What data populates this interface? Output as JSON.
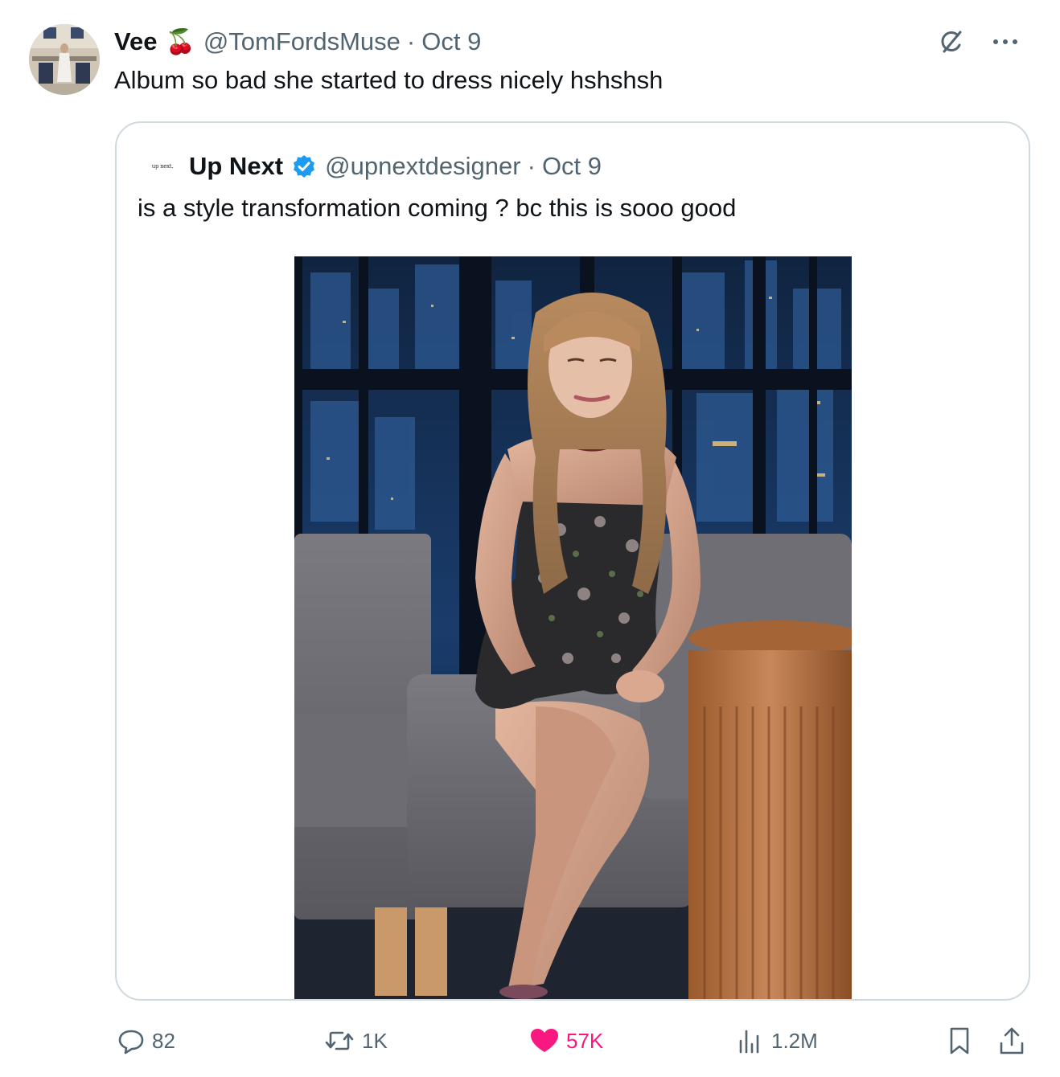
{
  "tweet": {
    "author_name": "Vee",
    "author_emoji": "🍒",
    "author_handle": "@TomFordsMuse",
    "separator": "·",
    "date": "Oct 9",
    "text": "Album so bad she started to dress nicely hshshsh"
  },
  "quoted": {
    "logo_text": "up next.",
    "author_name": "Up Next",
    "verified": true,
    "author_handle": "@upnextdesigner",
    "separator": "·",
    "date": "Oct 9",
    "text": "is a style transformation coming ? bc this is sooo good",
    "image_icon": "photo-woman-seated-talk-show"
  },
  "actions": {
    "replies": "82",
    "reposts": "1K",
    "likes": "57K",
    "views": "1.2M"
  },
  "colors": {
    "text_primary": "#0f1419",
    "text_secondary": "#536471",
    "border": "#cfd9de",
    "like": "#f91880",
    "verified": "#1d9bf0"
  },
  "icons": {
    "grok": "grok-icon",
    "more": "more-icon",
    "reply": "reply-icon",
    "repost": "repost-icon",
    "like": "heart-icon",
    "views": "views-icon",
    "bookmark": "bookmark-icon",
    "share": "share-icon"
  }
}
